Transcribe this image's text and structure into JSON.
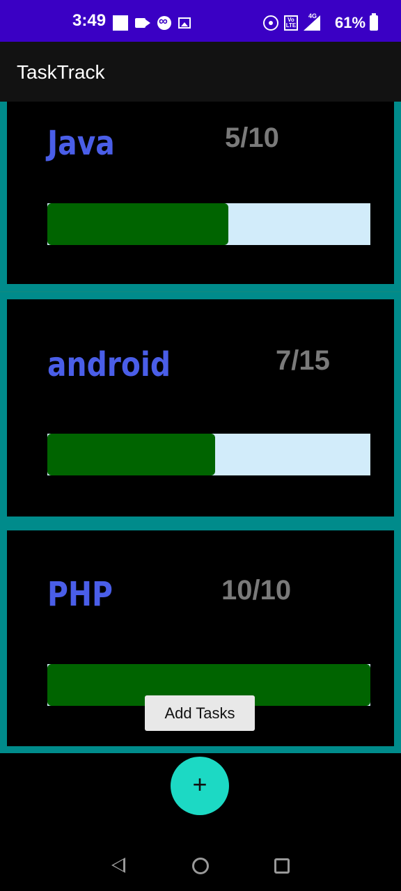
{
  "status_bar": {
    "time": "3:49",
    "network_label": "4G",
    "volte_label": "Vo LTE",
    "battery": "61%",
    "icons": [
      "square-notification-icon",
      "video-camera-icon",
      "link-icon",
      "image-icon",
      "hotspot-icon",
      "volte-icon",
      "signal-icon",
      "battery-icon"
    ]
  },
  "app_bar": {
    "title": "TaskTrack"
  },
  "tasks": [
    {
      "name": "Java",
      "progress_text": "5/10",
      "progress": 0.56
    },
    {
      "name": "android",
      "progress_text": "7/15",
      "progress": 0.52
    },
    {
      "name": "PHP",
      "progress_text": "10/10",
      "progress": 1.0
    }
  ],
  "tooltip": {
    "label": "Add Tasks"
  },
  "fab": {
    "icon": "plus-icon",
    "symbol": "+"
  },
  "nav_bar": {
    "icons": [
      "back-icon",
      "home-icon",
      "recents-icon"
    ]
  },
  "colors": {
    "status_bar": "#3a00c4",
    "card_border": "#008b8b",
    "task_name": "#4a5ee8",
    "progress_fill": "#006400",
    "progress_track": "#d2ecfa",
    "fab": "#1cd9c4"
  }
}
